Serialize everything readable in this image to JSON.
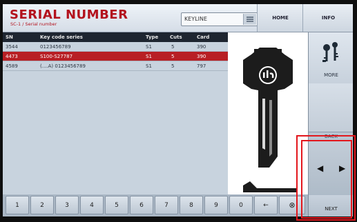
{
  "header": {
    "title": "SERIAL NUMBER",
    "subtitle": "SC-1 / Serial number",
    "keyline_value": "KEYLINE",
    "home_label": "HOME",
    "info_label": "INFO"
  },
  "table": {
    "columns": [
      "SN",
      "Key code series",
      "Type",
      "Cuts",
      "Card"
    ],
    "rows": [
      {
        "sn": "3544",
        "series": "0123456789",
        "type": "S1",
        "cuts": "5",
        "card": "390",
        "selected": false
      },
      {
        "sn": "4473",
        "series": "S100-S27787",
        "type": "S1",
        "cuts": "5",
        "card": "390",
        "selected": true
      },
      {
        "sn": "4589",
        "series": "(....A) 0123456789",
        "type": "S1",
        "cuts": "5",
        "card": "797",
        "selected": false
      }
    ]
  },
  "sidebar": {
    "more_label": "MORE",
    "back_label": "BACK",
    "next_label": "NEXT",
    "prev_arrow": "◀",
    "next_arrow": "▶"
  },
  "keypad": {
    "keys": [
      "1",
      "2",
      "3",
      "4",
      "5",
      "6",
      "7",
      "8",
      "9",
      "0",
      "←",
      "⊗"
    ]
  },
  "colors": {
    "accent_red": "#b3121d",
    "selected_row": "#b81f24",
    "highlight_box": "#e3161c"
  },
  "icons": {
    "more": "key-blanks-icon",
    "keypad_clear": "clear-icon"
  }
}
